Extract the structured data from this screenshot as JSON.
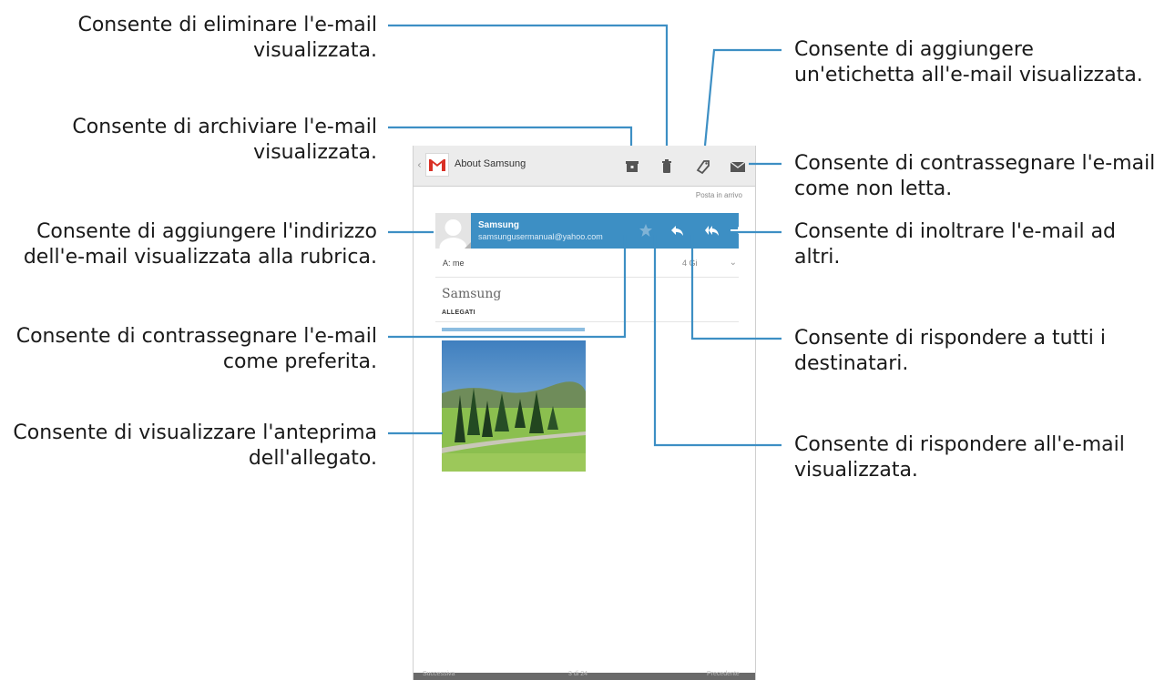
{
  "annotations": {
    "delete": {
      "l1": "Consente di eliminare l'e-mail",
      "l2": "visualizzata."
    },
    "archive": {
      "l1": "Consente di archiviare l'e-mail",
      "l2": "visualizzata."
    },
    "add_contact": {
      "l1": "Consente di aggiungere l'indirizzo",
      "l2": "dell'e-mail visualizzata alla rubrica."
    },
    "star": {
      "l1": "Consente di contrassegnare l'e-mail",
      "l2": "come preferita."
    },
    "preview": {
      "l1": "Consente di visualizzare l'anteprima",
      "l2": "dell'allegato."
    },
    "label": {
      "l1": "Consente di aggiungere",
      "l2": "un'etichetta all'e-mail visualizzata."
    },
    "mark_unread": {
      "l1": "Consente di contrassegnare l'e-mail",
      "l2": "come non letta."
    },
    "forward": {
      "l1": "Consente di inoltrare l'e-mail ad",
      "l2": "altri."
    },
    "reply_all": {
      "l1": "Consente di rispondere a tutti i",
      "l2": "destinatari."
    },
    "reply": {
      "l1": "Consente di rispondere all'e-mail",
      "l2": "visualizzata."
    }
  },
  "phone": {
    "back_glyph": "‹",
    "title": "About Samsung",
    "folder": "Posta in arrivo",
    "sender": {
      "name": "Samsung",
      "email": "samsungusermanual@yahoo.com"
    },
    "to_label": "A: me",
    "date": "4 Gi",
    "subject": "Samsung",
    "attachments_label": "ALLEGATI",
    "bottom": {
      "left": "Successiva",
      "center": "3 di 24",
      "right": "Precedente"
    }
  },
  "icons": {
    "actionbar": [
      "archive-icon",
      "delete-icon",
      "label-icon",
      "mark-unread-icon"
    ],
    "sender": [
      "star-icon",
      "reply-icon",
      "reply-all-icon",
      "forward-icon"
    ]
  },
  "colors": {
    "sender_bar": "#3d8fc4",
    "leader_line": "#3d8fc4",
    "gmail_red": "#d93025"
  }
}
